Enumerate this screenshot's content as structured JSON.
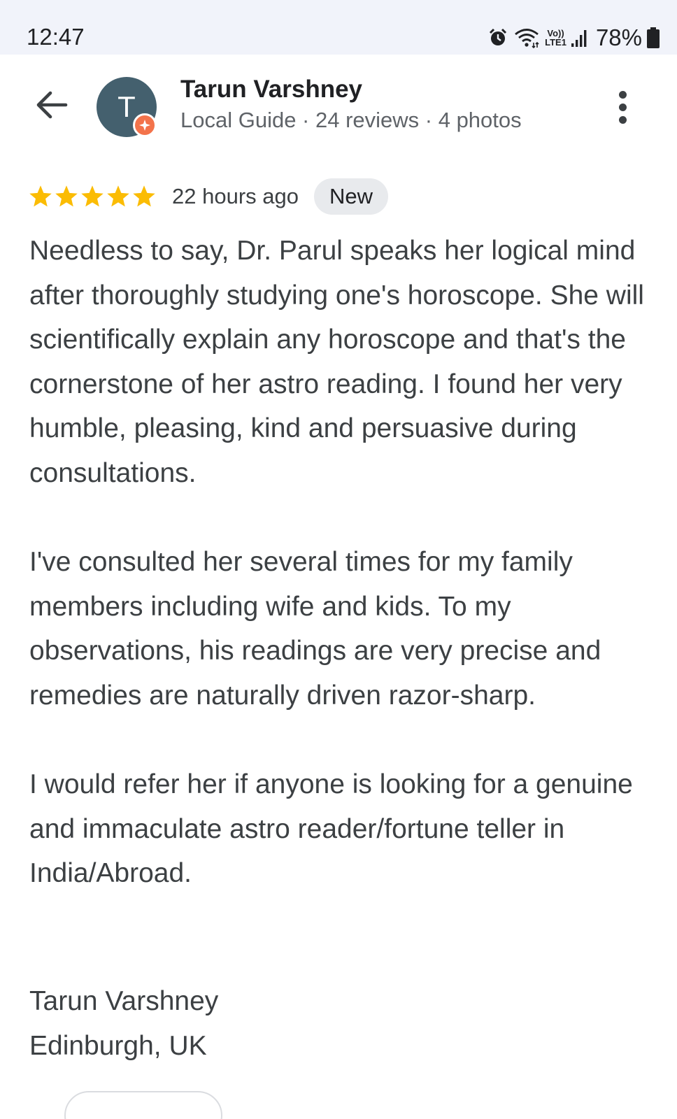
{
  "status_bar": {
    "time": "12:47",
    "network_label_top": "Vo))",
    "network_label_bottom": "LTE1",
    "battery_percent": "78%"
  },
  "header": {
    "avatar_letter": "T",
    "reviewer_name": "Tarun Varshney",
    "reviewer_meta": "Local Guide · 24 reviews · 4 photos"
  },
  "review": {
    "rating": 5,
    "time_ago": "22 hours ago",
    "badge": "New",
    "paragraphs": [
      "Needless to say, Dr. Parul speaks her logical mind after thoroughly studying one's horoscope. She will scientifically explain any horoscope and that's the cornerstone of her astro reading. I found her very humble, pleasing, kind and persuasive during consultations.",
      "I've consulted her several times for my family members including wife and kids. To my observations, his readings are very precise and remedies are naturally driven razor-sharp.",
      "I would refer her if anyone is looking for a genuine and immaculate astro reader/fortune teller in India/Abroad."
    ],
    "signature_name": "Tarun Varshney",
    "signature_location": "Edinburgh, UK"
  },
  "colors": {
    "star": "#fbbc04",
    "avatar_bg": "#44606e",
    "guide_badge": "#f3734b",
    "status_bar_bg": "#f1f3fa",
    "chip_bg": "#e8eaed"
  },
  "icons": {
    "back": "arrow-back-icon",
    "more": "more-vert-icon",
    "alarm": "alarm-icon",
    "wifi": "wifi-icon",
    "signal": "signal-icon",
    "battery": "battery-icon",
    "local_guide": "local-guide-badge-icon",
    "star": "star-icon"
  }
}
